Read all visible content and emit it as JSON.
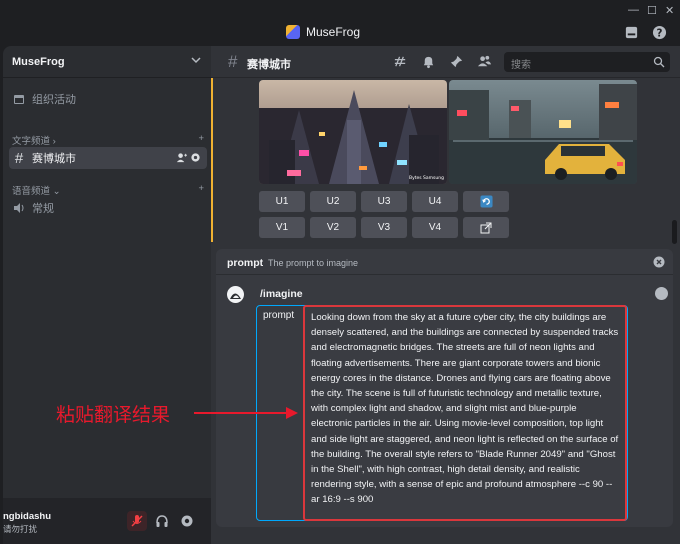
{
  "app": {
    "title": "MuseFrog"
  },
  "server": {
    "name": "MuseFrog"
  },
  "sidebar": {
    "events_label": "组织活动",
    "text_category": "文字频道",
    "text_channels": [
      {
        "name": "赛博城市",
        "active": true
      }
    ],
    "voice_category": "语音频道",
    "voice_channels": [
      {
        "name": "常规"
      }
    ]
  },
  "user": {
    "name": "ngbidashu",
    "status": "请勿打扰"
  },
  "channel": {
    "name": "赛博城市"
  },
  "search": {
    "placeholder": "搜索"
  },
  "image_watermark": "Bytes Samsung",
  "actions": {
    "upscale": [
      "U1",
      "U2",
      "U3",
      "U4"
    ],
    "variation": [
      "V1",
      "V2",
      "V3",
      "V4"
    ]
  },
  "composer": {
    "option_name": "prompt",
    "option_desc": "The prompt to imagine",
    "command": "/imagine",
    "field_label": "prompt",
    "prompt_text": "Looking down from the sky at a future cyber city, the city buildings are densely scattered, and the buildings are connected by suspended tracks and electromagnetic bridges. The streets are full of neon lights and floating advertisements. There are giant corporate towers and bionic energy cores in the distance. Drones and flying cars are floating above the city. The scene is full of futuristic technology and metallic texture, with complex light and shadow, and slight mist and blue-purple electronic particles in the air. Using movie-level composition, top light and side light are staggered, and neon light is reflected on the surface of the building. The overall style refers to \"Blade Runner 2049\" and \"Ghost in the Shell\", with high contrast, high detail density, and realistic rendering style, with a sense of epic and profound atmosphere --c 90 --ar 16:9 --s 900"
  },
  "annotation": {
    "text": "粘贴翻译结果"
  },
  "colors": {
    "accent": "#f0b232",
    "highlight": "#da373c",
    "focus": "#00a8fc",
    "annotation": "#e8192c"
  }
}
